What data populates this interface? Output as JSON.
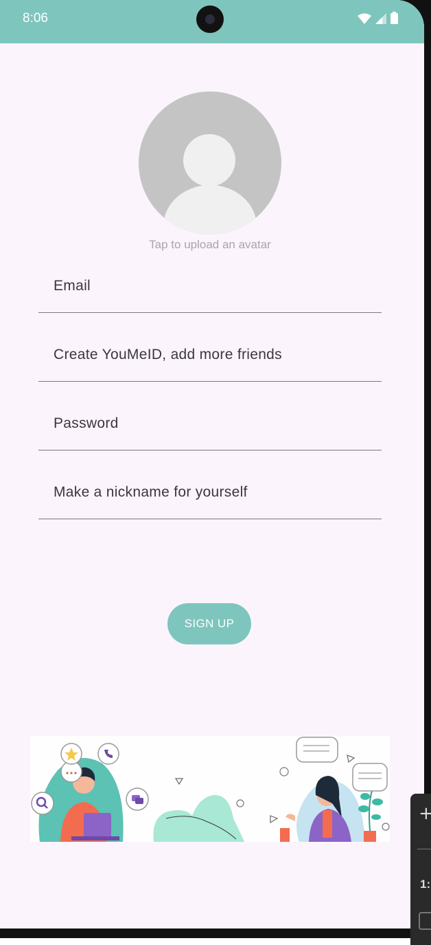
{
  "status_bar": {
    "time": "8:06"
  },
  "avatar": {
    "hint": "Tap to upload an avatar"
  },
  "form": {
    "fields": [
      {
        "placeholder": "Email"
      },
      {
        "placeholder": "Create YouMeID, add more friends"
      },
      {
        "placeholder": "Password"
      },
      {
        "placeholder": "Make a nickname for yourself"
      }
    ],
    "signup_label": "SIGN UP"
  },
  "side_panel": {
    "number": "1:"
  },
  "colors": {
    "accent": "#7ec5bd",
    "background": "#fcf4fc",
    "underline": "#7a7680"
  },
  "icons": [
    "wifi-icon",
    "cellular-icon",
    "battery-icon",
    "default-avatar-icon",
    "plus-icon"
  ]
}
